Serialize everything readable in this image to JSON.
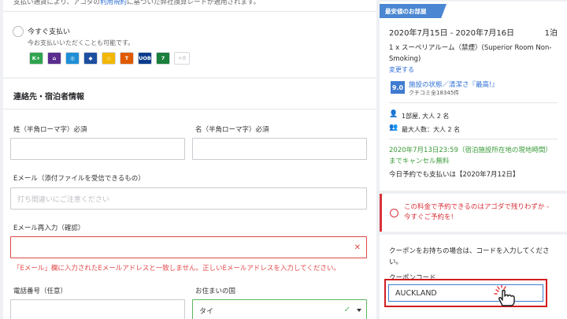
{
  "payment": {
    "note_prefix": "支払い通貨により、アゴダの",
    "note_link": "利用規約",
    "note_suffix": "に基づいた弊社換算レートが適用されます。",
    "option_title": "今すぐ支払い",
    "option_sub": "今お支払いいただくことも可能です。",
    "logos": [
      {
        "label": "K+",
        "color": "#2ea44f"
      },
      {
        "label": "⌂",
        "color": "#5b2d8e"
      },
      {
        "label": "◎",
        "color": "#1e8fd6"
      },
      {
        "label": "◆",
        "color": "#1d4fa0"
      },
      {
        "label": "◇",
        "color": "#f2b705"
      },
      {
        "label": "T",
        "color": "#e05a00"
      },
      {
        "label": "UOB",
        "color": "#0b3c8c"
      },
      {
        "label": "7",
        "color": "#1a7f3c"
      }
    ],
    "more": "+8"
  },
  "contact": {
    "title": "連絡先・宿泊者情報",
    "last_name_label": "姓（半角ローマ字）必須",
    "first_name_label": "名（半角ローマ字）必須",
    "email_label": "Eメール（添付ファイルを受信できるもの）",
    "email_placeholder": "打ち間違いにご注意ください",
    "email_confirm_label": "Eメール再入力（確認）",
    "error_message": "「Eメール」欄に入力されたEメールアドレスと一致しません。正しいEメールアドレスを入力してください。",
    "phone_label": "電話番号（任意）",
    "country_label": "お住まいの国",
    "country_value": "タイ"
  },
  "summary": {
    "badge": "最安値のお部屋",
    "dates": "2020年7月15日 - 2020年7月16日",
    "nights": "1泊",
    "room_line1": "1 x スーペリアルーム（禁煙）(Superior Room Non-",
    "room_line2": "Smoking)",
    "change": "変更する",
    "score": "9.0",
    "facility": "施設の状態／清潔さ『最高!』",
    "reviews": "クチコミ全18345件",
    "rooms_guests": "1部屋, 大人 2 名",
    "max_guests": "最大人数：大人 2 名",
    "cancel_line1": "2020年7月13日23:59（宿泊施設所在地の現地時間）",
    "cancel_line2": "までキャンセル無料",
    "today": "今日予約でも支払いは【2020年7月12日】"
  },
  "alert": {
    "line1": "この料金で予約できるのはアゴダで残りわずか -",
    "line2": "今すぐご予約を!"
  },
  "coupon": {
    "help_line1": "クーポンをお持ちの場合は、コードを入力してくださ",
    "help_line2": "い。",
    "label": "クーポンコード",
    "value": "AUCKLAND"
  }
}
